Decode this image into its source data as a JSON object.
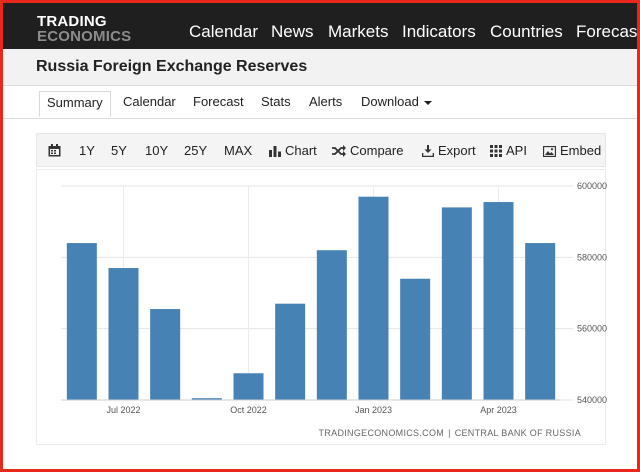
{
  "app": {
    "logo_line1": "TRADING",
    "logo_line2": "ECONOMICS",
    "nav": [
      "Calendar",
      "News",
      "Markets",
      "Indicators",
      "Countries",
      "Forecast"
    ]
  },
  "page": {
    "title": "Russia Foreign Exchange Reserves"
  },
  "tabs": [
    {
      "label": "Summary",
      "active": true
    },
    {
      "label": "Calendar",
      "active": false
    },
    {
      "label": "Forecast",
      "active": false
    },
    {
      "label": "Stats",
      "active": false
    },
    {
      "label": "Alerts",
      "active": false
    },
    {
      "label": "Download",
      "active": false,
      "dropdown": true
    }
  ],
  "toolbar": {
    "ranges": [
      "1Y",
      "5Y",
      "10Y",
      "25Y",
      "MAX"
    ],
    "chart": "Chart",
    "compare": "Compare",
    "export": "Export",
    "api": "API",
    "embed": "Embed"
  },
  "source": {
    "site": "TRADINGECONOMICS.COM",
    "separator": "|",
    "provider": "CENTRAL BANK OF RUSSIA"
  },
  "colors": {
    "bar": "#4682b4",
    "nav_bg": "#1f1f1f",
    "frame": "#e8281d"
  },
  "chart_data": {
    "type": "bar",
    "categories": [
      "2022-06",
      "2022-07",
      "2022-08",
      "2022-09",
      "2022-10",
      "2022-11",
      "2022-12",
      "2023-01",
      "2023-02",
      "2023-03",
      "2023-04",
      "2023-05"
    ],
    "values": [
      584000,
      577000,
      565500,
      540500,
      547500,
      567000,
      582000,
      597000,
      574000,
      594000,
      595500,
      584000
    ],
    "x_tick_labels": [
      "Jul 2022",
      "Oct 2022",
      "Jan 2023",
      "Apr 2023"
    ],
    "y_tick_labels": [
      "600000",
      "580000",
      "560000",
      "540000"
    ],
    "ylim": [
      540000,
      600000
    ],
    "grid": true,
    "y_axis_side": "right",
    "title": "",
    "xlabel": "",
    "ylabel": ""
  }
}
